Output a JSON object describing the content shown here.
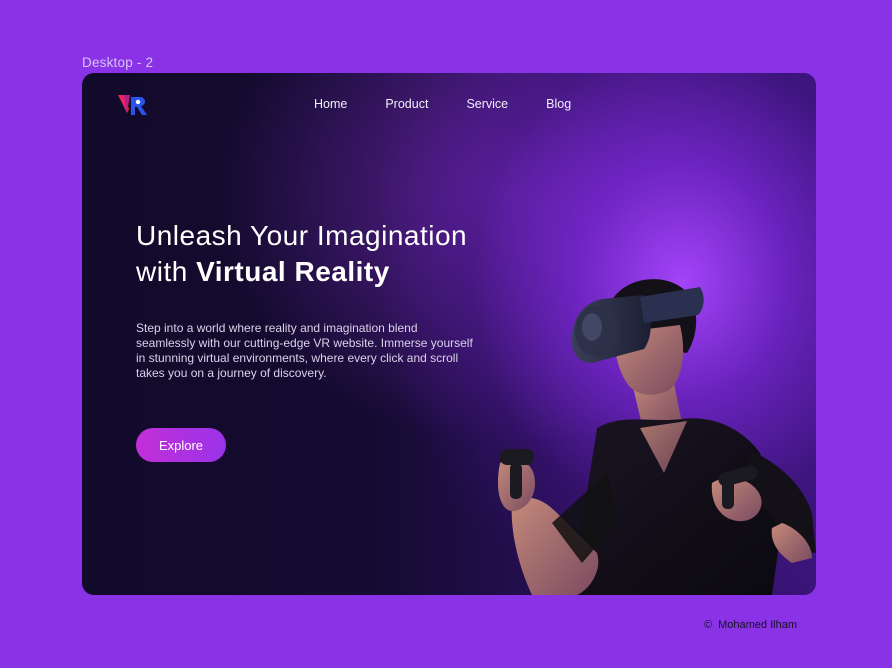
{
  "frame": {
    "label": "Desktop - 2"
  },
  "header": {
    "logo_icon": "vr-logo-icon",
    "nav": [
      {
        "label": "Home"
      },
      {
        "label": "Product"
      },
      {
        "label": "Service"
      },
      {
        "label": "Blog"
      }
    ]
  },
  "hero": {
    "headline_line1": "Unleash Your Imagination",
    "headline_line2_prefix": "with ",
    "headline_line2_strong": "Virtual Reality",
    "description": "Step into a world where reality and imagination blend seamlessly with our cutting-edge VR website. Immerse yourself in stunning virtual environments, where every click and scroll takes you on a journey of discovery.",
    "cta_label": "Explore",
    "image_icon": "vr-user-illustration"
  },
  "footer": {
    "copyright_symbol": "©",
    "author": "Mohamed Ilham"
  },
  "colors": {
    "page_bg": "#8a33e6",
    "frame_bg": "#150b32",
    "accent_glow": "#a846ff",
    "cta_start": "#c22fd8",
    "cta_end": "#9a33e8"
  }
}
